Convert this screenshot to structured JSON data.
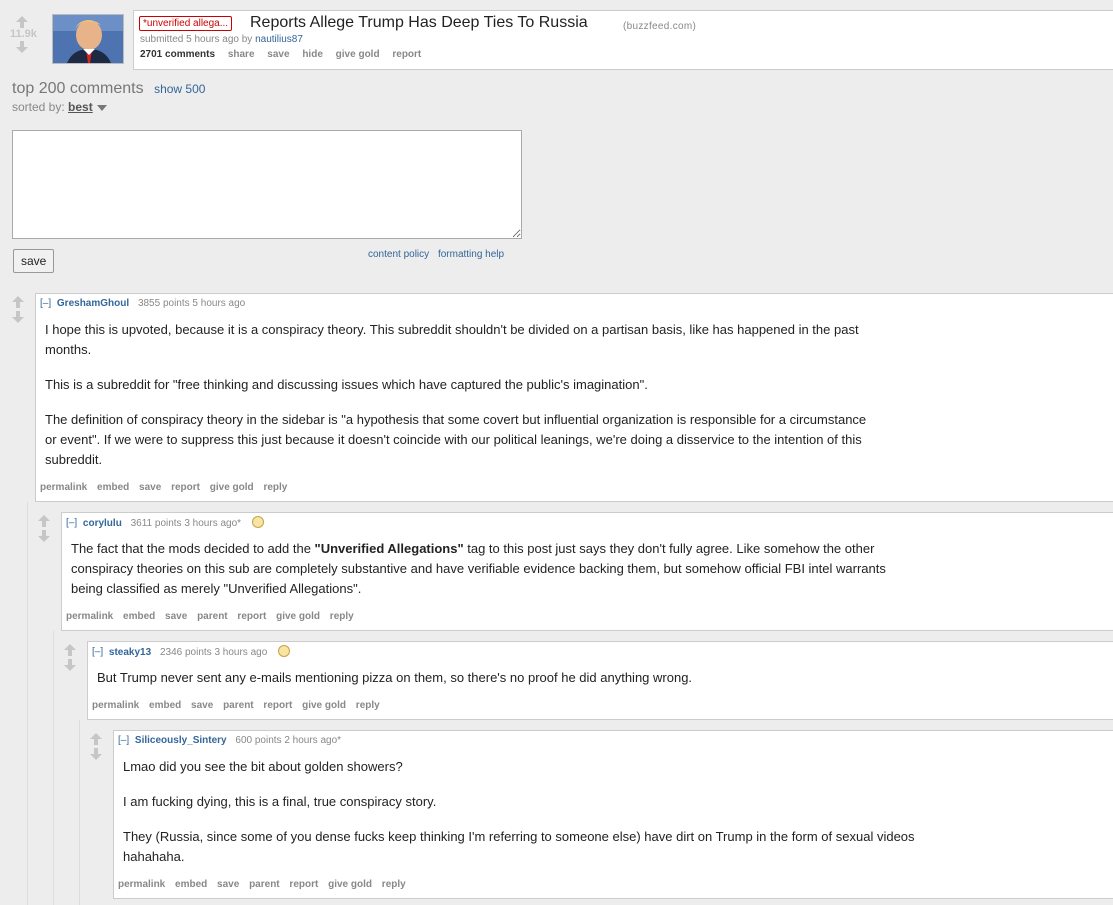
{
  "post": {
    "score": "11.9k",
    "flair": "*unverified allega...",
    "title": "Reports Allege Trump Has Deep Ties To Russia",
    "domain": "(buzzfeed.com)",
    "submitted_prefix": "submitted 5 hours ago by",
    "author": "nautilius87",
    "buttons": [
      "2701 comments",
      "share",
      "save",
      "hide",
      "give gold",
      "report"
    ]
  },
  "comments_header": {
    "title": "top 200 comments",
    "show_more": "show 500",
    "sorted_label": "sorted by:",
    "sort_value": "best"
  },
  "editor": {
    "save_label": "save",
    "links": [
      "content policy",
      "formatting help"
    ]
  },
  "comments": [
    {
      "author": "GreshamGhoul",
      "points": "3855 points 5 hours ago",
      "paragraphs": [
        "I hope this is upvoted, because it is a conspiracy theory. This subreddit shouldn't be divided on a partisan basis, like has happened in the past months.",
        "This is a subreddit for \"free thinking and discussing issues which have captured the public's imagination\".",
        "The definition of conspiracy theory in the sidebar is \"a hypothesis that some covert but influential organization is responsible for a circumstance or event\". If we were to suppress this just because it doesn't coincide with our political leanings, we're doing a disservice to the intention of this subreddit."
      ],
      "buttons": [
        "permalink",
        "embed",
        "save",
        "report",
        "give gold",
        "reply"
      ]
    },
    {
      "author": "corylulu",
      "points": "3611 points 3 hours ago*",
      "body_pre": "The fact that the mods decided to add the ",
      "body_bold": "\"Unverified Allegations\"",
      "body_post": " tag to this post just says they don't fully agree. Like somehow the other conspiracy theories on this sub are completely substantive and have verifiable evidence backing them, but somehow official FBI intel warrants being classified as merely \"Unverified Allegations\".",
      "buttons": [
        "permalink",
        "embed",
        "save",
        "parent",
        "report",
        "give gold",
        "reply"
      ]
    },
    {
      "author": "steaky13",
      "points": "2346 points 3 hours ago",
      "paragraphs": [
        "But Trump never sent any e-mails mentioning pizza on them, so there's no proof he did anything wrong."
      ],
      "buttons": [
        "permalink",
        "embed",
        "save",
        "parent",
        "report",
        "give gold",
        "reply"
      ]
    },
    {
      "author": "Siliceously_Sintery",
      "points": "600 points 2 hours ago*",
      "paragraphs": [
        "Lmao did you see the bit about golden showers?",
        "I am fucking dying, this is a final, true conspiracy story.",
        "They (Russia, since some of you dense fucks keep thinking I'm referring to someone else) have dirt on Trump in the form of sexual videos hahahaha."
      ],
      "buttons": [
        "permalink",
        "embed",
        "save",
        "parent",
        "report",
        "give gold",
        "reply"
      ]
    }
  ]
}
